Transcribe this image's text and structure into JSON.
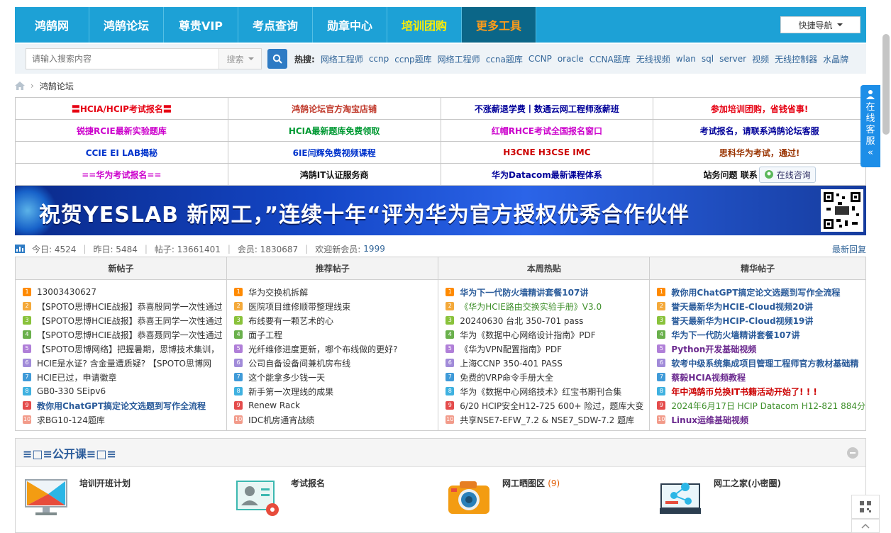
{
  "nav": {
    "items": [
      "鸿鹄网",
      "鸿鹄论坛",
      "尊贵VIP",
      "考点查询",
      "勋章中心",
      "培训团购",
      "更多工具"
    ],
    "quick_nav": "快捷导航"
  },
  "search": {
    "placeholder": "请输入搜索内容",
    "type": "搜索",
    "hot_label": "热搜:",
    "hot": [
      "网络工程师",
      "ccnp",
      "ccnp题库",
      "网络工程师",
      "ccna题库",
      "CCNP",
      "oracle",
      "CCNA题库",
      "无线视频",
      "wlan",
      "sql",
      "server",
      "视频",
      "无线控制器",
      "水晶牌"
    ]
  },
  "breadcrumb": {
    "current": "鸿鹄论坛"
  },
  "links": [
    [
      "〓HCIA/HCIP考试报名〓",
      "鸿鹄论坛官方淘宝店铺",
      "不涨薪退学费丨数通云网工程师涨薪班",
      "参加培训团购，省钱省事!"
    ],
    [
      "锐捷RCIE最新实验题库",
      "HCIA最新题库免费领取",
      "红帽RHCE考试全国报名窗口",
      "考试报名，请联系鸿鹄论坛客服"
    ],
    [
      "CCIE EI LAB揭秘",
      "6IE闫辉免费视频课程",
      "H3CNE H3CSE IMC",
      "思科华为考试，通过!"
    ],
    [
      "==华为考试报名==",
      "鸿鹄IT认证服务商",
      "华为Datacom最新课程体系",
      "站务问题 联系"
    ]
  ],
  "online_consult": "在线咨询",
  "banner": {
    "text": "祝贺YESLAB 新网工，”连续十年“评为华为官方授权优秀合作伙伴"
  },
  "stats": {
    "today": "今日: 4524",
    "yesterday": "昨日: 5484",
    "posts": "帖子: 13661401",
    "members": "会员: 1830687",
    "welcome": "欢迎新会员:",
    "new_member": "1999",
    "latest_reply": "最新回复"
  },
  "columns": [
    {
      "title": "新帖子",
      "items": [
        "13003430627",
        "【SPOTO思博HCIE战报】恭喜殷同学一次性通过",
        "【SPOTO思博HCIE战报】恭喜王同学一次性通过",
        "【SPOTO思博HCIE战报】恭喜聂同学一次性通过",
        "【SPOTO思博网络】把握暑期，思博技术集训，",
        "HCIE是水证? 含金量遭质疑? 【SPOTO思博网",
        "HCIE已过，申请徽章",
        "GB0-330 SEipv6",
        "教你用ChatGPT搞定论文选题到写作全流程",
        "求BG10-124题库"
      ]
    },
    {
      "title": "推荐帖子",
      "items": [
        "华为交换机拆解",
        "医院项目维修顺带整理线束",
        "布线要有一颗艺术的心",
        "面子工程",
        "光纤维修进度更新，哪个布线做的更好?",
        "公司自备设备间兼机房布线",
        "这个能拿多少钱一天",
        "新手第一次理线的成果",
        "Renew Rack",
        "IDC机房通宵战绩"
      ]
    },
    {
      "title": "本周热贴",
      "items": [
        "华为下一代防火墙精讲套餐107讲",
        "《华为HCIE路由交换实验手册》V3.0",
        "20240630 台北 350-701 pass",
        "华为《数据中心网络设计指南》PDF",
        "《华为VPN配置指南》PDF",
        "上海CCNP 350-401 PASS",
        "免费的VRP命令手册大全",
        "华为《数据中心网络技术》红宝书期刊合集",
        "6/20 HCIP安全H12-725 600+ 险过，题库大变",
        "共享NSE7-EFW_7.2 & NSE7_SDW-7.2 题库"
      ]
    },
    {
      "title": "精华帖子",
      "items": [
        "教你用ChatGPT搞定论文选题到写作全流程",
        "誉天最新华为HCIE-Cloud视频20讲",
        "誉天最新华为HCIP-Cloud视频19讲",
        "华为下一代防火墙精讲套餐107讲",
        "Python开发基础视频",
        "软考中级系统集成项目管理工程师官方教材基础精",
        "蔡毅HCIA视频教程",
        "年中鸿鹄币兑换IT书籍活动开始了! ! !",
        "2024年6月17日 HCIP Datacom H12-821 884分",
        "Linux运维基础视频"
      ]
    }
  ],
  "course": {
    "title": "≡□≡公开课≡□≡",
    "items": [
      {
        "label": "培训开班计划",
        "count": ""
      },
      {
        "label": "考试报名",
        "count": ""
      },
      {
        "label": "网工晒图区",
        "count": "(9)"
      },
      {
        "label": "网工之家(小密圈)",
        "count": ""
      }
    ]
  },
  "side": {
    "service": [
      "在",
      "线",
      "客",
      "服",
      "«"
    ]
  },
  "colors": {
    "nav_bg": "#1da1d6",
    "accent_blue": "#2e7bc4",
    "link": "#336699"
  }
}
